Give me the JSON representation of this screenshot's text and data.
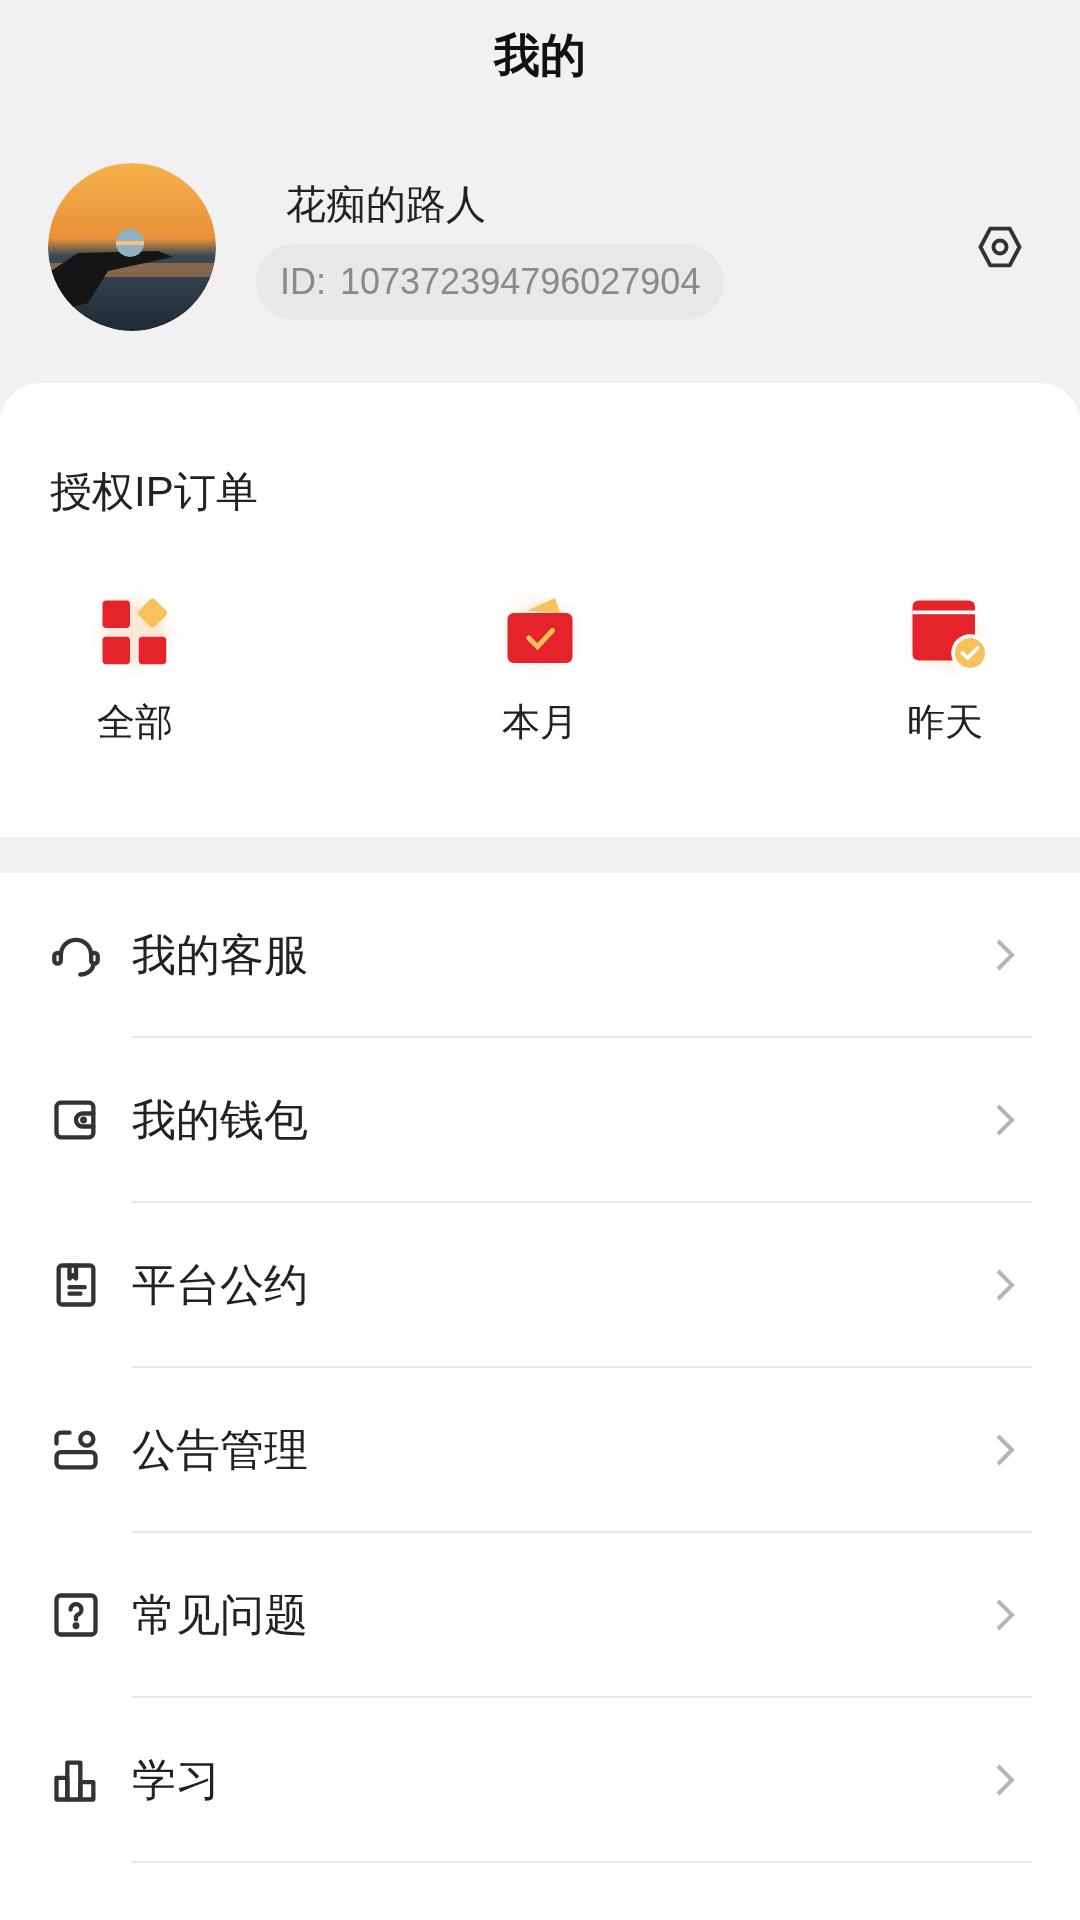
{
  "header": {
    "title": "我的"
  },
  "profile": {
    "name": "花痴的路人",
    "id_label": "ID:",
    "id_value": "107372394796027904"
  },
  "orders": {
    "title": "授权IP订单",
    "items": [
      {
        "kind": "all",
        "label": "全部"
      },
      {
        "kind": "month",
        "label": "本月"
      },
      {
        "kind": "yesterday",
        "label": "昨天"
      }
    ]
  },
  "menu": [
    {
      "kind": "headset",
      "label": "我的客服"
    },
    {
      "kind": "wallet",
      "label": "我的钱包"
    },
    {
      "kind": "book",
      "label": "平台公约"
    },
    {
      "kind": "notice",
      "label": "公告管理"
    },
    {
      "kind": "question",
      "label": "常见问题"
    },
    {
      "kind": "chart",
      "label": "学习"
    }
  ]
}
